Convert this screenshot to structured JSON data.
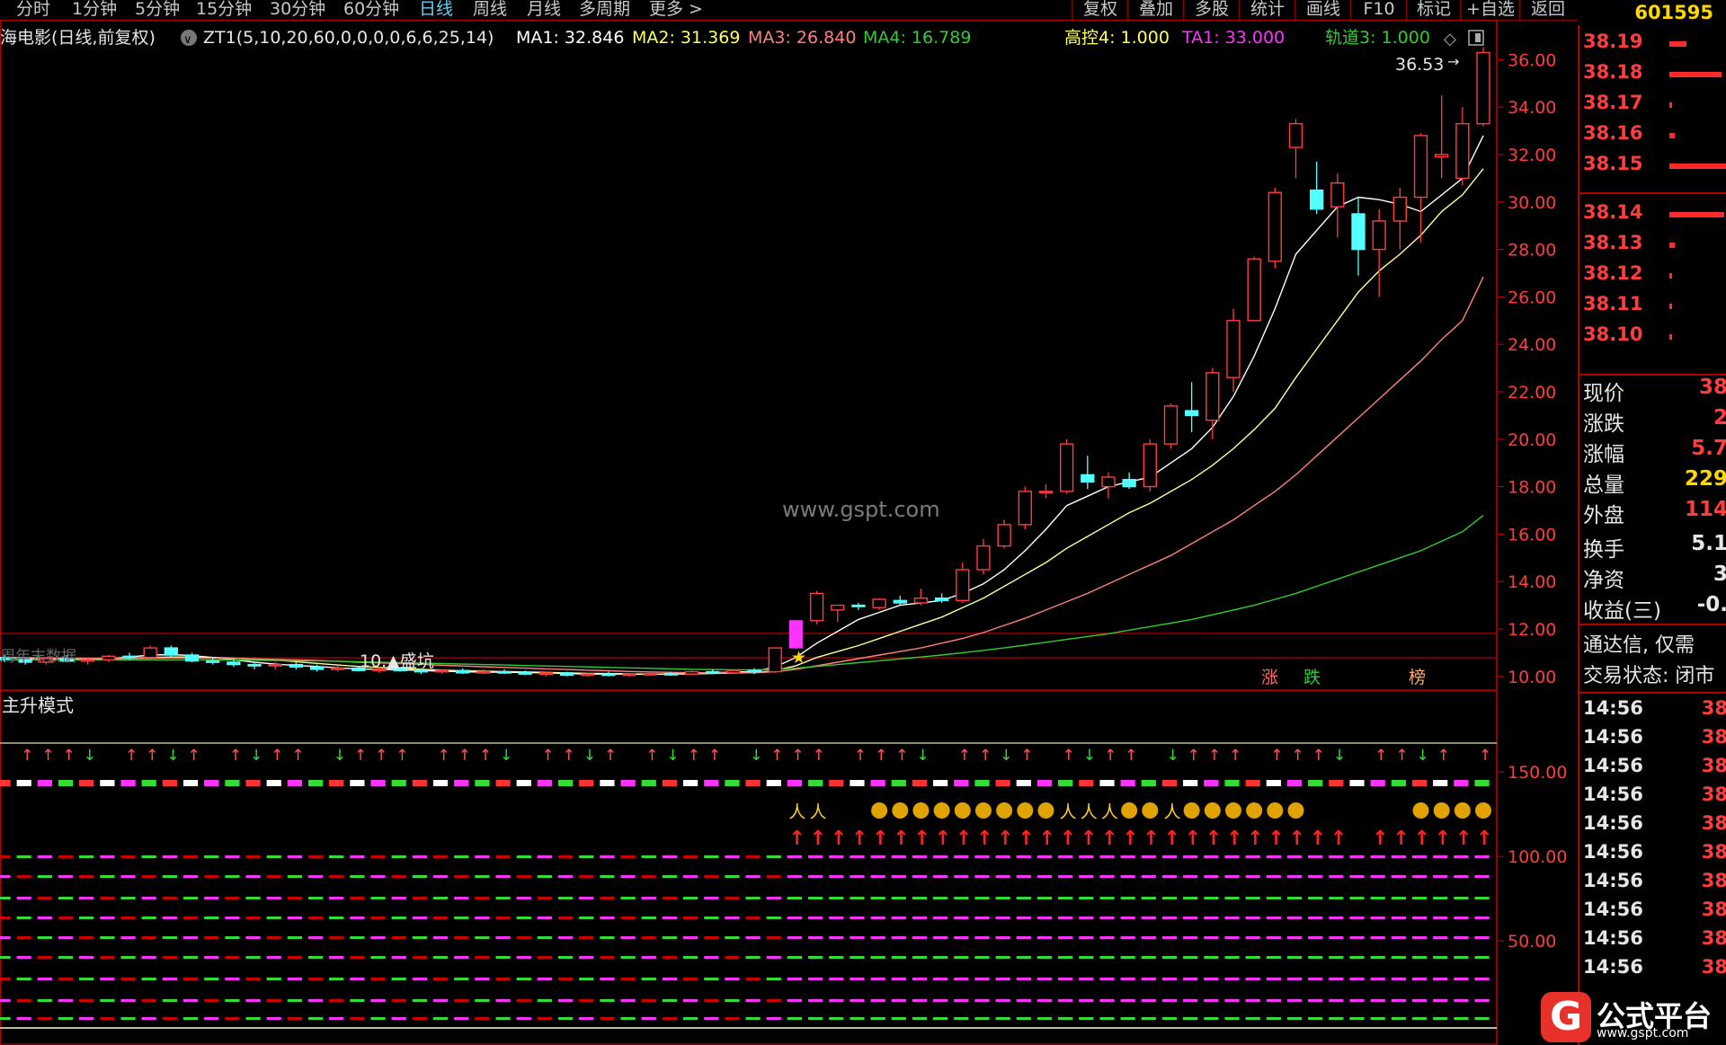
{
  "toolbar": {
    "timeframes": [
      "分时",
      "1分钟",
      "5分钟",
      "15分钟",
      "30分钟",
      "60分钟",
      "日线",
      "周线",
      "月线",
      "多周期",
      "更多 >"
    ],
    "active_timeframe": "日线",
    "right_buttons": [
      "复权",
      "叠加",
      "多股",
      "统计",
      "画线",
      "F10",
      "标记",
      "+自选",
      "返回"
    ]
  },
  "stock_code": "601595",
  "header": {
    "name": "海电影(日线,前复权)",
    "formula": "ZT1(5,10,20,60,0,0,0,0,6,6,25,14)",
    "ma1": "MA1: 32.846",
    "ma2": "MA2: 31.369",
    "ma3": "MA3: 26.840",
    "ma4": "MA4: 16.789",
    "gk": "高控4: 1.000",
    "ta": "TA1: 33.000",
    "track": "轨道3: 1.000",
    "colors": {
      "ma1": "#ffffff",
      "ma2": "#ffff66",
      "ma3": "#ff8080",
      "ma4": "#33cc33",
      "gk": "#ffff66",
      "ta": "#ff33ff",
      "track": "#33cc33"
    }
  },
  "watermark": "www.gspt.com",
  "chart_data": {
    "type": "candlestick",
    "y_axis": {
      "min": 9.5,
      "max": 37.0,
      "ticks": [
        "36.00",
        "34.00",
        "32.00",
        "30.00",
        "28.00",
        "26.00",
        "24.00",
        "22.00",
        "20.00",
        "18.00",
        "16.00",
        "14.00",
        "12.00",
        "10.00"
      ]
    },
    "max_label": "36.53",
    "pit_label": "10.▲盛坑",
    "left_label": "周年末数据",
    "flags": [
      "涨",
      "跌",
      "榜"
    ],
    "candles": [
      [
        10.8,
        10.9,
        10.6,
        10.7
      ],
      [
        10.7,
        10.8,
        10.5,
        10.6
      ],
      [
        10.6,
        10.8,
        10.5,
        10.75
      ],
      [
        10.75,
        10.9,
        10.6,
        10.65
      ],
      [
        10.65,
        10.8,
        10.5,
        10.7
      ],
      [
        10.7,
        10.9,
        10.6,
        10.85
      ],
      [
        10.85,
        11.0,
        10.7,
        10.8
      ],
      [
        10.8,
        11.3,
        10.8,
        11.2
      ],
      [
        11.2,
        11.3,
        10.8,
        10.9
      ],
      [
        10.9,
        11.0,
        10.6,
        10.65
      ],
      [
        10.65,
        10.8,
        10.5,
        10.6
      ],
      [
        10.6,
        10.7,
        10.4,
        10.5
      ],
      [
        10.5,
        10.6,
        10.3,
        10.45
      ],
      [
        10.45,
        10.6,
        10.3,
        10.5
      ],
      [
        10.5,
        10.6,
        10.3,
        10.4
      ],
      [
        10.4,
        10.5,
        10.2,
        10.3
      ],
      [
        10.3,
        10.45,
        10.2,
        10.35
      ],
      [
        10.35,
        10.4,
        10.2,
        10.25
      ],
      [
        10.25,
        10.4,
        10.15,
        10.3
      ],
      [
        10.3,
        10.4,
        10.2,
        10.25
      ],
      [
        10.25,
        10.35,
        10.1,
        10.2
      ],
      [
        10.2,
        10.3,
        10.1,
        10.25
      ],
      [
        10.25,
        10.35,
        10.1,
        10.15
      ],
      [
        10.15,
        10.3,
        10.1,
        10.2
      ],
      [
        10.2,
        10.3,
        10.1,
        10.18
      ],
      [
        10.18,
        10.25,
        10.05,
        10.1
      ],
      [
        10.1,
        10.2,
        10.0,
        10.15
      ],
      [
        10.15,
        10.2,
        10.0,
        10.05
      ],
      [
        10.05,
        10.15,
        10.0,
        10.1
      ],
      [
        10.1,
        10.2,
        10.0,
        10.08
      ],
      [
        10.08,
        10.15,
        10.0,
        10.1
      ],
      [
        10.1,
        10.2,
        10.02,
        10.12
      ],
      [
        10.12,
        10.2,
        10.02,
        10.1
      ],
      [
        10.1,
        10.25,
        10.05,
        10.2
      ],
      [
        10.2,
        10.3,
        10.1,
        10.15
      ],
      [
        10.15,
        10.3,
        10.1,
        10.25
      ],
      [
        10.25,
        10.35,
        10.1,
        10.2
      ],
      [
        10.2,
        11.1,
        10.15,
        11.2
      ],
      [
        11.2,
        12.35,
        11.15,
        12.35
      ],
      [
        12.35,
        13.6,
        12.2,
        13.5
      ],
      [
        12.8,
        13.0,
        12.3,
        13.0
      ],
      [
        13.0,
        13.1,
        12.8,
        12.95
      ],
      [
        12.9,
        13.3,
        12.8,
        13.25
      ],
      [
        13.2,
        13.4,
        13.0,
        13.1
      ],
      [
        13.1,
        13.7,
        13.0,
        13.3
      ],
      [
        13.3,
        13.5,
        13.1,
        13.2
      ],
      [
        13.2,
        14.8,
        13.1,
        14.5
      ],
      [
        14.5,
        15.8,
        14.3,
        15.5
      ],
      [
        15.5,
        16.6,
        15.4,
        16.4
      ],
      [
        16.4,
        18.0,
        16.2,
        17.8
      ],
      [
        17.8,
        18.1,
        17.5,
        17.8
      ],
      [
        17.8,
        20.0,
        17.7,
        19.8
      ],
      [
        18.5,
        19.3,
        17.9,
        18.2
      ],
      [
        18.0,
        18.6,
        17.5,
        18.4
      ],
      [
        18.3,
        18.6,
        17.9,
        18.0
      ],
      [
        18.0,
        20.0,
        17.8,
        19.8
      ],
      [
        19.8,
        21.5,
        19.6,
        21.4
      ],
      [
        21.2,
        22.4,
        20.3,
        21.0
      ],
      [
        20.8,
        23.0,
        20.0,
        22.8
      ],
      [
        22.6,
        25.5,
        22.0,
        25.0
      ],
      [
        25.0,
        27.7,
        25.0,
        27.6
      ],
      [
        27.5,
        30.6,
        27.2,
        30.4
      ],
      [
        32.3,
        33.5,
        31.0,
        33.3
      ],
      [
        30.5,
        31.7,
        29.5,
        29.7
      ],
      [
        29.8,
        31.2,
        28.5,
        30.8
      ],
      [
        29.5,
        30.2,
        26.9,
        28.0
      ],
      [
        28.0,
        29.7,
        26.0,
        29.2
      ],
      [
        29.2,
        30.6,
        28.0,
        30.2
      ],
      [
        30.2,
        32.9,
        28.3,
        32.8
      ],
      [
        31.9,
        34.5,
        31.0,
        32.0
      ],
      [
        31.0,
        34.0,
        30.7,
        33.3
      ],
      [
        33.3,
        36.53,
        33.2,
        36.3
      ]
    ],
    "ma_lines": {
      "ma5": [
        10.8,
        10.75,
        10.7,
        10.7,
        10.72,
        10.75,
        10.82,
        10.9,
        10.92,
        10.88,
        10.8,
        10.7,
        10.6,
        10.52,
        10.46,
        10.42,
        10.36,
        10.32,
        10.3,
        10.28,
        10.25,
        10.22,
        10.2,
        10.18,
        10.18,
        10.16,
        10.15,
        10.12,
        10.1,
        10.1,
        10.1,
        10.1,
        10.1,
        10.12,
        10.15,
        10.18,
        10.2,
        10.4,
        10.8,
        11.4,
        11.9,
        12.4,
        12.7,
        13.0,
        13.1,
        13.2,
        13.5,
        13.9,
        14.5,
        15.3,
        16.2,
        17.2,
        17.6,
        18.0,
        18.2,
        18.4,
        19.0,
        19.6,
        20.5,
        21.8,
        23.5,
        25.5,
        27.8,
        28.8,
        29.8,
        30.2,
        30.1,
        29.9,
        29.6,
        30.3,
        31.0,
        32.8
      ],
      "ma10": [
        10.8,
        10.78,
        10.75,
        10.73,
        10.73,
        10.74,
        10.76,
        10.8,
        10.82,
        10.82,
        10.8,
        10.77,
        10.73,
        10.69,
        10.62,
        10.55,
        10.48,
        10.42,
        10.38,
        10.35,
        10.3,
        10.27,
        10.24,
        10.22,
        10.2,
        10.19,
        10.17,
        10.15,
        10.13,
        10.12,
        10.11,
        10.1,
        10.1,
        10.11,
        10.12,
        10.14,
        10.16,
        10.25,
        10.45,
        10.8,
        11.05,
        11.3,
        11.6,
        11.9,
        12.2,
        12.5,
        12.9,
        13.3,
        13.8,
        14.3,
        14.8,
        15.4,
        15.9,
        16.4,
        16.9,
        17.3,
        17.8,
        18.3,
        18.9,
        19.6,
        20.4,
        21.3,
        22.6,
        23.8,
        25.0,
        26.2,
        27.1,
        27.8,
        28.6,
        29.6,
        30.3,
        31.4
      ],
      "ma20": [
        10.8,
        10.79,
        10.78,
        10.77,
        10.76,
        10.76,
        10.76,
        10.77,
        10.78,
        10.78,
        10.77,
        10.76,
        10.74,
        10.72,
        10.7,
        10.67,
        10.64,
        10.6,
        10.57,
        10.54,
        10.51,
        10.47,
        10.44,
        10.41,
        10.38,
        10.35,
        10.32,
        10.29,
        10.26,
        10.24,
        10.21,
        10.19,
        10.17,
        10.16,
        10.15,
        10.15,
        10.15,
        10.2,
        10.3,
        10.45,
        10.6,
        10.75,
        10.9,
        11.05,
        11.2,
        11.4,
        11.6,
        11.85,
        12.15,
        12.45,
        12.8,
        13.15,
        13.5,
        13.9,
        14.3,
        14.7,
        15.1,
        15.6,
        16.1,
        16.6,
        17.2,
        17.8,
        18.5,
        19.3,
        20.1,
        20.9,
        21.7,
        22.5,
        23.3,
        24.2,
        25.0,
        26.84
      ],
      "ma60": [
        10.7,
        10.7,
        10.7,
        10.7,
        10.7,
        10.7,
        10.7,
        10.7,
        10.7,
        10.7,
        10.7,
        10.69,
        10.68,
        10.67,
        10.66,
        10.65,
        10.64,
        10.62,
        10.6,
        10.58,
        10.56,
        10.54,
        10.52,
        10.5,
        10.48,
        10.46,
        10.44,
        10.42,
        10.4,
        10.38,
        10.36,
        10.34,
        10.32,
        10.3,
        10.29,
        10.28,
        10.28,
        10.3,
        10.35,
        10.42,
        10.5,
        10.58,
        10.66,
        10.74,
        10.82,
        10.9,
        11.0,
        11.1,
        11.2,
        11.32,
        11.44,
        11.56,
        11.68,
        11.8,
        11.95,
        12.1,
        12.25,
        12.4,
        12.6,
        12.8,
        13.0,
        13.25,
        13.5,
        13.8,
        14.1,
        14.4,
        14.7,
        15.0,
        15.3,
        15.7,
        16.1,
        16.789
      ]
    }
  },
  "indicator": {
    "title": "主升模式",
    "y_ticks": [
      "150.00",
      "100.00",
      "50.00"
    ]
  },
  "orderbook": {
    "prices": [
      "38.19",
      "38.18",
      "38.17",
      "38.16",
      "38.15",
      "38.14",
      "38.13",
      "38.12",
      "38.11",
      "38.10"
    ],
    "bar_fraction": [
      0.3,
      0.9,
      0.05,
      0.1,
      1.0,
      0.95,
      0.1,
      0.05,
      0.05,
      0.05
    ]
  },
  "quote": [
    {
      "label": "现价",
      "value": "38",
      "color": "#ff3d3d"
    },
    {
      "label": "涨跌",
      "value": "2",
      "color": "#ff3d3d"
    },
    {
      "label": "涨幅",
      "value": "5.7",
      "color": "#ff3d3d"
    },
    {
      "label": "总量",
      "value": "229",
      "color": "#ffd700"
    },
    {
      "label": "外盘",
      "value": "114",
      "color": "#ff3d3d"
    },
    {
      "label": "换手",
      "value": "5.1",
      "color": "#e6e6e6"
    },
    {
      "label": "净资",
      "value": "3",
      "color": "#e6e6e6"
    },
    {
      "label": "收益(三)",
      "value": "-0.",
      "color": "#e6e6e6"
    }
  ],
  "notice": [
    "通达信, 仅需",
    "交易状态: 闭市"
  ],
  "ticks": [
    {
      "time": "14:56",
      "price": "38"
    },
    {
      "time": "14:56",
      "price": "38"
    },
    {
      "time": "14:56",
      "price": "38"
    },
    {
      "time": "14:56",
      "price": "38"
    },
    {
      "time": "14:56",
      "price": "38"
    },
    {
      "time": "14:56",
      "price": "38"
    },
    {
      "time": "14:56",
      "price": "38"
    },
    {
      "time": "14:56",
      "price": "38"
    },
    {
      "time": "14:56",
      "price": "38"
    },
    {
      "time": "14:56",
      "price": "38"
    }
  ],
  "logo": {
    "title": "公式平台",
    "url": "www.gspt.com",
    "mark": "G"
  }
}
